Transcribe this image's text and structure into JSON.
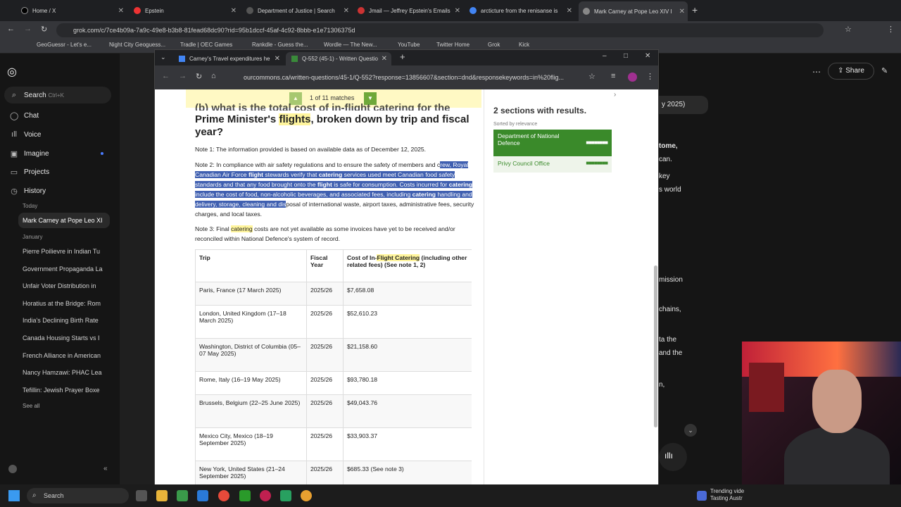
{
  "outer_tabs": [
    {
      "label": "Home / X"
    },
    {
      "label": "Epstein"
    },
    {
      "label": "Department of Justice | Search"
    },
    {
      "label": "Jmail — Jeffrey Epstein's Emails"
    },
    {
      "label": "arcticture from the renisanse is"
    },
    {
      "label": "Mark Carney at Pope Leo XIV I"
    }
  ],
  "outer_url": "grok.com/c/7ce4b09a-7a9c-49e8-b3b8-81fead68dc90?rid=95b1dccf-45af-4c92-8bbb-e1e71306375d",
  "bookmarks": [
    "GeoGuessr - Let's e...",
    "Night City Geoguess...",
    "Tradle | OEC Games",
    "Rankdle - Guess the...",
    "Wordle — The New...",
    "YouTube",
    "Twitter Home",
    "Grok",
    "Kick"
  ],
  "grok": {
    "search_label": "Search",
    "search_shortcut": "Ctrl+K",
    "nav": [
      "Chat",
      "Voice",
      "Imagine",
      "Projects",
      "History"
    ],
    "today_label": "Today",
    "today_item": "Mark Carney at Pope Leo XI",
    "january_label": "January",
    "history": [
      "Pierre Poilievre in Indian Tu",
      "Government Propaganda La",
      "Unfair Voter Distribution in",
      "Horatius at the Bridge: Rom",
      "India's Declining Birth Rate",
      "Canada Housing Starts vs I",
      "French Alliance in American",
      "Nancy Hamzawi: PHAC Lea",
      "Tefillin: Jewish Prayer Boxe"
    ],
    "see_all": "See all",
    "share_label": "Share",
    "right_fragments": [
      "y 2025)",
      "tome,",
      "can.",
      "key",
      "s world",
      "mission",
      "chains,",
      "ta the",
      "and the",
      "n,"
    ]
  },
  "inner_tabs": [
    {
      "label": "Carney's Travel expenditures he"
    },
    {
      "label": "Q-552 (45-1) - Written Questio"
    }
  ],
  "inner_url": "ourcommons.ca/written-questions/45-1/Q-552?response=13856607&section=dnd&responsekeywords=in%20flig...",
  "findbar": {
    "count": "1 of 11 matches",
    "up": "▲",
    "down": "▼"
  },
  "heading_top": "(b) what is the total cost of in-flight catering for the",
  "heading_pm": "Prime Minister's",
  "heading_flights": "flights",
  "heading_rest": ", broken down by trip and fiscal",
  "heading_year": "year?",
  "note1": "Note 1: The information provided is based on available data as of December 12, 2025.",
  "note2_a": "Note 2: In compliance with air safety regulations and to ensure the safety of members and c",
  "note2_sel_1": "rew, Royal Canadian Air Force ",
  "note2_flight": "flight",
  "note2_sel_2": " stewards verify that ",
  "note2_catering": "catering",
  "note2_sel_3": " services used meet Canadian food safety standards and that any food brought onto the ",
  "note2_flight2": "flight",
  "note2_sel_4": " is safe for consumption. Costs incurred for ",
  "note2_catering2": "catering",
  "note2_sel_5": " include the cost of food, non-alcoholic beverages, and associated fees, including ",
  "note2_catering3": "catering",
  "note2_sel_6": " handling and delivery, storage, cleaning and dis",
  "note2_b": "posal of international waste, airport taxes, administrative fees, security charges, and local taxes.",
  "note3_a": "Note 3: Final ",
  "note3_catering": "catering",
  "note3_b": " costs are not yet available as some invoices have yet to be received and/or reconciled within National Defence's system of record.",
  "table": {
    "headers": [
      "Trip",
      "Fiscal Year",
      "Cost of In-",
      "Flight Catering",
      " (including other related fees) (See note 1, 2)"
    ],
    "rows": [
      {
        "trip": "Paris, France (17 March 2025)",
        "year": "2025/26",
        "cost": "$7,658.08"
      },
      {
        "trip": "London, United Kingdom (17–18 March 2025)",
        "year": "2025/26",
        "cost": "$52,610.23"
      },
      {
        "trip": "Washington, District of Columbia (05–07 May 2025)",
        "year": "2025/26",
        "cost": "$21,158.60"
      },
      {
        "trip": "Rome, Italy (16–19 May 2025)",
        "year": "2025/26",
        "cost": "$93,780.18"
      },
      {
        "trip": "Brussels, Belgium (22–25 June 2025)",
        "year": "2025/26",
        "cost": "$49,043.76"
      },
      {
        "trip": "Mexico City, Mexico (18–19 September 2025)",
        "year": "2025/26",
        "cost": "$33,903.37"
      },
      {
        "trip": "New York, United States (21–24 September 2025)",
        "year": "2025/26",
        "cost": "$685.33 (See note 3)"
      }
    ]
  },
  "results": {
    "title": "2 sections with results.",
    "sorted": "Sorted by relevance",
    "items": [
      "Department of National Defence",
      "Privy Council Office"
    ],
    "bars": "■■■■■■■■"
  },
  "taskbar": {
    "search": "Search",
    "trending_title": "Trending vide",
    "trending_sub": "Tasting Austr"
  },
  "colors": {
    "accent_green": "#6ea83a",
    "selection": "#3f5fb0",
    "highlight": "#fff59d"
  }
}
